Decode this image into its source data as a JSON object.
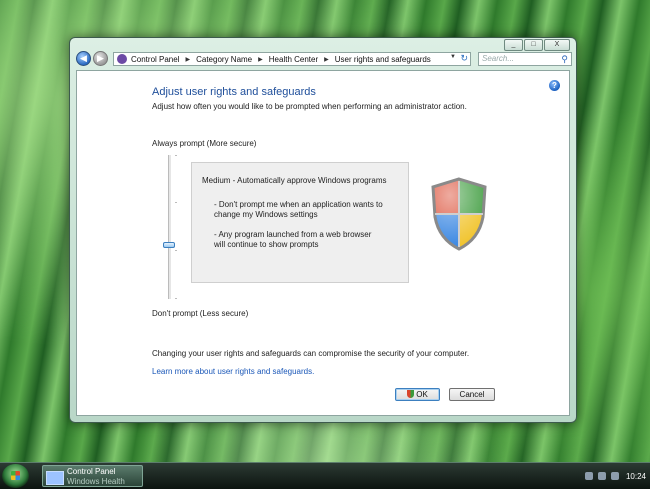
{
  "window": {
    "controls": {
      "minimize": "_",
      "maximize": "□",
      "close": "X"
    },
    "address": {
      "crumbs": [
        "Control Panel",
        "Category Name",
        "Health Center",
        "User rights and safeguards"
      ]
    },
    "search_placeholder": "Search..."
  },
  "content": {
    "title": "Adjust user rights and safeguards",
    "subtitle": "Adjust how often you would like to be prompted when performing an administrator action.",
    "slider": {
      "top_label": "Always prompt (More secure)",
      "bottom_label": "Don't prompt (Less secure)",
      "level": 0.63
    },
    "description": {
      "heading": "Medium - Automatically approve Windows programs",
      "items": [
        "- Don't prompt me when an application wants to change my Windows settings",
        "- Any program launched from a web browser will continue to show prompts"
      ]
    },
    "warning": "Changing your user rights and safeguards can compromise the security of your computer.",
    "learn_link": "Learn more about user rights and safeguards.",
    "ok_label": "OK",
    "cancel_label": "Cancel"
  },
  "taskbar": {
    "task_title": "Control Panel",
    "task_subtitle": "Windows Health",
    "clock": "10:24"
  },
  "colors": {
    "title": "#1e4e9a",
    "link": "#1a57b8",
    "shield_red": "#d9452c",
    "shield_green": "#3a9a3a",
    "shield_blue": "#2d7fe0",
    "shield_yellow": "#f0c020"
  }
}
